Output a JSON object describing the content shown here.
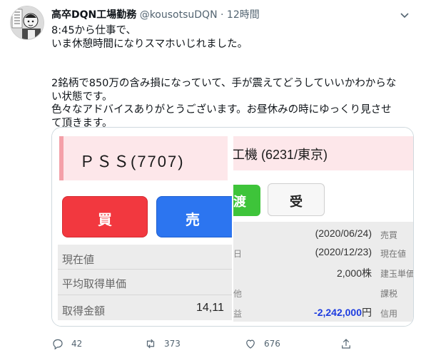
{
  "tweet": {
    "display_name": "高卒DQN工場勤務",
    "handle": "@kousotsuDQN",
    "separator": "·",
    "time": "12時間",
    "lines_1": [
      "8:45から仕事で、",
      "いま休憩時間になりスマホいじれました。"
    ],
    "lines_2": [
      "2銘柄で850万の含み損になっていて、手が震えてどうしていいかわからな",
      "い状態です。",
      "色々なアドバイスありがとうございます。お昼休みの時にゆっくり見させ",
      "て頂きます。"
    ]
  },
  "image_left": {
    "stock_title": "ＰＳＳ(7707)",
    "buy_label": "買",
    "sell_label": "売",
    "rows": [
      {
        "label": "現在値",
        "value": ""
      },
      {
        "label": "平均取得単価",
        "value": ""
      },
      {
        "label": "取得金額",
        "value": "14,11"
      }
    ]
  },
  "image_right": {
    "stock_title": "工機 (6231/東京)",
    "green_button_label": "渡",
    "uke_label": "受",
    "rows": [
      {
        "cut": "",
        "value": "(2020/06/24)",
        "label": "売買"
      },
      {
        "cut": "日",
        "value": "(2020/12/23)",
        "label": "現在値"
      },
      {
        "cut": "",
        "value": "2,000株",
        "label": "建玉単価"
      },
      {
        "cut": "他",
        "value": "",
        "label": "課税"
      }
    ],
    "pl_cut": "益",
    "pl_value": "-2,242,000",
    "pl_unit": "円",
    "pl_label": "信用"
  },
  "actions": {
    "reply_count": "42",
    "retweet_count": "373",
    "like_count": "676"
  },
  "colors": {
    "buy": "#f2383f",
    "sell": "#2c75f0",
    "green": "#3ec43a",
    "negative": "#1d3ce0"
  }
}
